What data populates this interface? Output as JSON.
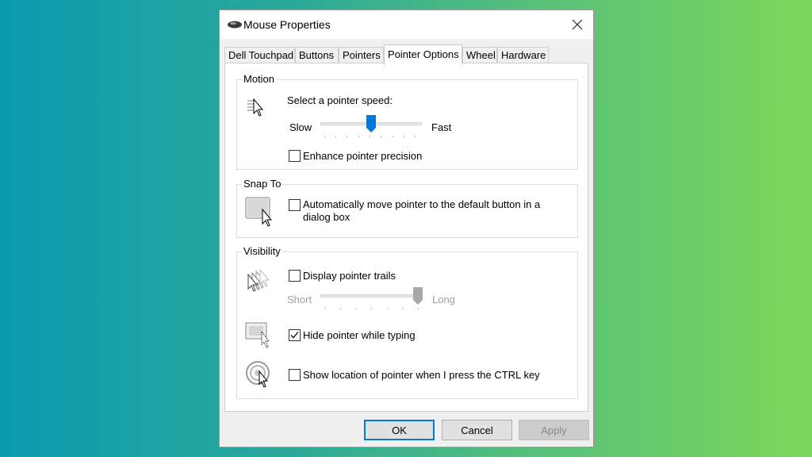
{
  "window": {
    "title": "Mouse Properties",
    "close_glyph": "✕"
  },
  "tabs": [
    {
      "label": "Dell Touchpad",
      "active": false
    },
    {
      "label": "Buttons",
      "active": false
    },
    {
      "label": "Pointers",
      "active": false
    },
    {
      "label": "Pointer Options",
      "active": true
    },
    {
      "label": "Wheel",
      "active": false
    },
    {
      "label": "Hardware",
      "active": false
    }
  ],
  "motion": {
    "group_label": "Motion",
    "speed_label": "Select a pointer speed:",
    "slow_label": "Slow",
    "fast_label": "Fast",
    "speed_value": 0.5,
    "enhance_precision": {
      "label": "Enhance pointer precision",
      "checked": false
    }
  },
  "snap_to": {
    "group_label": "Snap To",
    "auto_move": {
      "label_line1": "Automatically move pointer to the default button in a",
      "label_line2": "dialog box",
      "checked": false
    }
  },
  "visibility": {
    "group_label": "Visibility",
    "trails": {
      "label": "Display pointer trails",
      "checked": false
    },
    "short_label": "Short",
    "long_label": "Long",
    "trail_value": 1.0,
    "hide_typing": {
      "label": "Hide pointer while typing",
      "checked": true
    },
    "show_location": {
      "label": "Show location of pointer when I press the CTRL key",
      "checked": false
    }
  },
  "buttons": {
    "ok": "OK",
    "cancel": "Cancel",
    "apply": "Apply"
  },
  "colors": {
    "accent": "#0078d7",
    "disabled_text": "#a0a0a0"
  },
  "icons": [
    "mouse-icon",
    "pointer-speed-icon",
    "snap-to-icon",
    "pointer-trails-icon",
    "hide-pointer-icon",
    "ctrl-locate-icon",
    "checkmark-icon",
    "close-icon"
  ]
}
